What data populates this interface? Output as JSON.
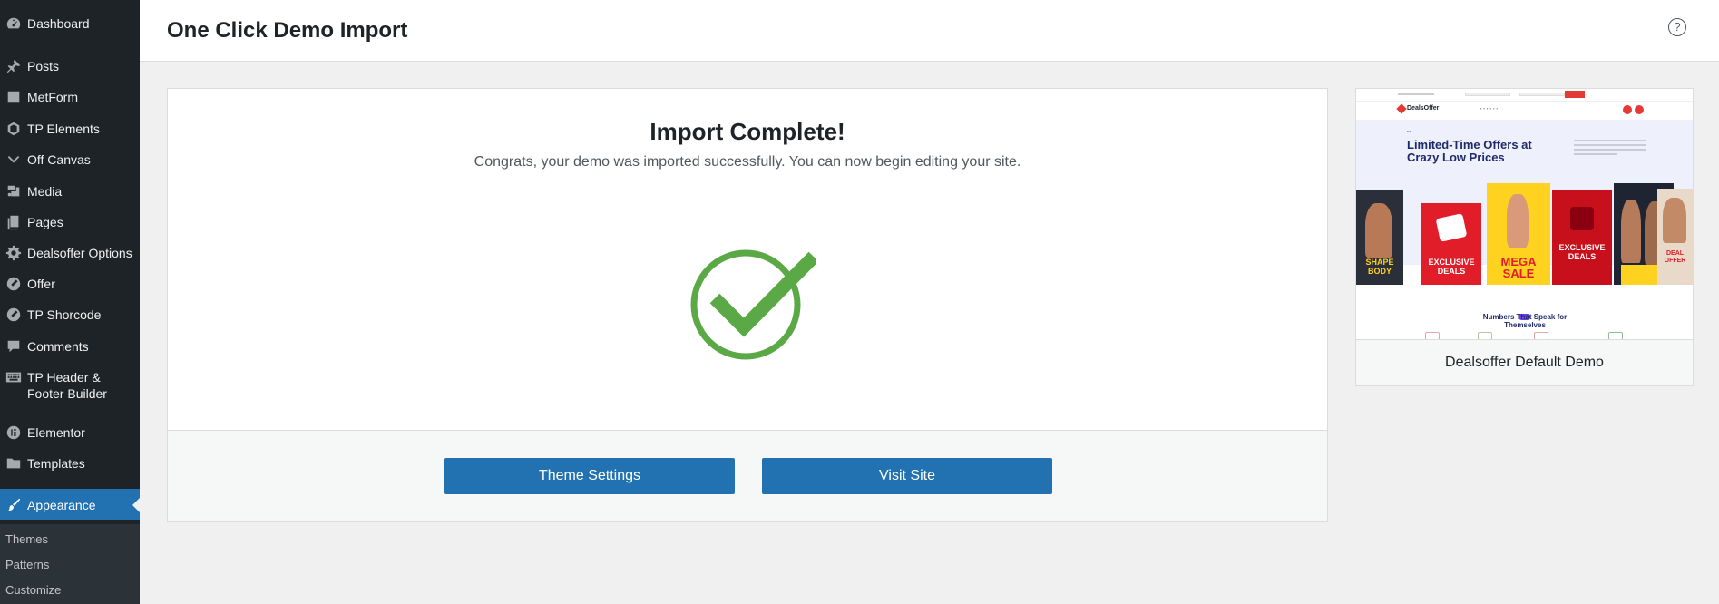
{
  "sidebar": {
    "items": [
      {
        "label": "Dashboard",
        "icon": "dashboard-icon"
      },
      {
        "label": "Posts",
        "icon": "pushpin-icon"
      },
      {
        "label": "MetForm",
        "icon": "form-icon"
      },
      {
        "label": "TP Elements",
        "icon": "elements-icon"
      },
      {
        "label": "Off Canvas",
        "icon": "chevron-down-icon"
      },
      {
        "label": "Media",
        "icon": "media-icon"
      },
      {
        "label": "Pages",
        "icon": "pages-icon"
      },
      {
        "label": "Dealsoffer Options",
        "icon": "gear-icon"
      },
      {
        "label": "Offer",
        "icon": "offer-icon"
      },
      {
        "label": "TP Shorcode",
        "icon": "shortcode-icon"
      },
      {
        "label": "Comments",
        "icon": "comment-icon"
      },
      {
        "label": "TP Header & Footer Builder",
        "icon": "keyboard-icon"
      },
      {
        "label": "Elementor",
        "icon": "elementor-icon"
      },
      {
        "label": "Templates",
        "icon": "folder-icon"
      },
      {
        "label": "Appearance",
        "icon": "paintbrush-icon",
        "active": true
      }
    ],
    "submenu": [
      "Themes",
      "Patterns",
      "Customize"
    ]
  },
  "header": {
    "title": "One Click Demo Import",
    "help_icon": "help-icon",
    "help_glyph": "?"
  },
  "import_panel": {
    "title": "Import Complete!",
    "subtitle": "Congrats, your demo was imported successfully. You can now begin editing your site.",
    "success_icon": "checkmark-icon",
    "buttons": {
      "theme_settings": "Theme Settings",
      "visit_site": "Visit Site"
    }
  },
  "demo_card": {
    "caption": "Dealsoffer Default Demo",
    "preview": {
      "logo": "DealsOffer",
      "hero_title": "Limited-Time Offers at Crazy Low Prices",
      "tiles": [
        "SHAPE BODY",
        "EXCLUSIVE DEALS",
        "MEGA SALE",
        "EXCLUSIVE DEALS",
        "",
        "DEAL OFFER"
      ],
      "section_title": "Numbers That Speak for Themselves"
    }
  },
  "colors": {
    "sidebar_bg": "#1d2327",
    "accent": "#2271b1",
    "success": "#5ba946"
  }
}
